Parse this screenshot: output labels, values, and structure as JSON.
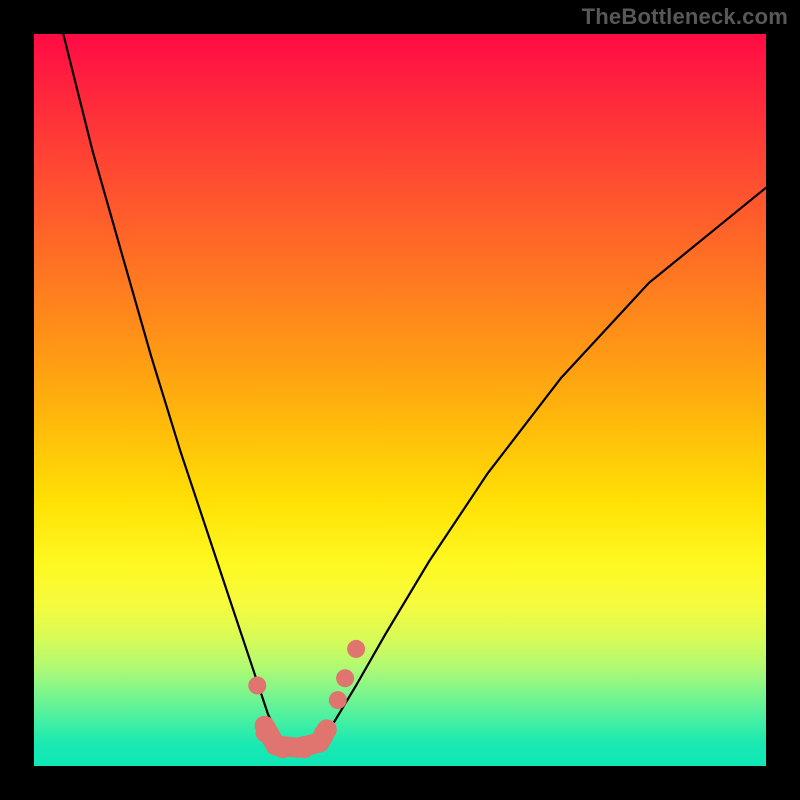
{
  "watermark": "TheBottleneck.com",
  "colors": {
    "frame": "#000000",
    "curve": "#000000",
    "marker": "#e0746e",
    "gradient_top": "#ff0b44",
    "gradient_bottom": "#0fe7b6"
  },
  "chart_data": {
    "type": "line",
    "title": "",
    "xlabel": "",
    "ylabel": "",
    "xlim": [
      0,
      100
    ],
    "ylim": [
      0,
      100
    ],
    "note": "Axes are unlabeled; values are estimated from pixel positions. y=0 is the bottom (green) edge, y=100 is the top (red) edge. The curve is a V-shaped valley with minimum near x≈35, y≈2. Pink markers highlight the trough region.",
    "series": [
      {
        "name": "bottleneck-curve",
        "x": [
          4,
          8,
          12,
          16,
          20,
          24,
          27,
          30,
          32,
          34,
          36,
          38,
          41,
          44,
          48,
          54,
          62,
          72,
          84,
          100
        ],
        "y": [
          100,
          84,
          70,
          56,
          43,
          31,
          22,
          13,
          7,
          3,
          2,
          3,
          6,
          11,
          18,
          28,
          40,
          53,
          66,
          79
        ]
      }
    ],
    "markers": [
      {
        "x": 30.5,
        "y": 11
      },
      {
        "x": 31.5,
        "y": 4.5
      },
      {
        "x": 34,
        "y": 2.3
      },
      {
        "x": 37,
        "y": 2.3
      },
      {
        "x": 39.5,
        "y": 4.5
      },
      {
        "x": 41.5,
        "y": 9
      },
      {
        "x": 42.5,
        "y": 12
      },
      {
        "x": 44,
        "y": 16
      }
    ],
    "trough_path": [
      {
        "x": 31.5,
        "y": 5.5
      },
      {
        "x": 33,
        "y": 2.8
      },
      {
        "x": 36,
        "y": 2.5
      },
      {
        "x": 39,
        "y": 3.2
      },
      {
        "x": 40,
        "y": 5.0
      }
    ]
  }
}
